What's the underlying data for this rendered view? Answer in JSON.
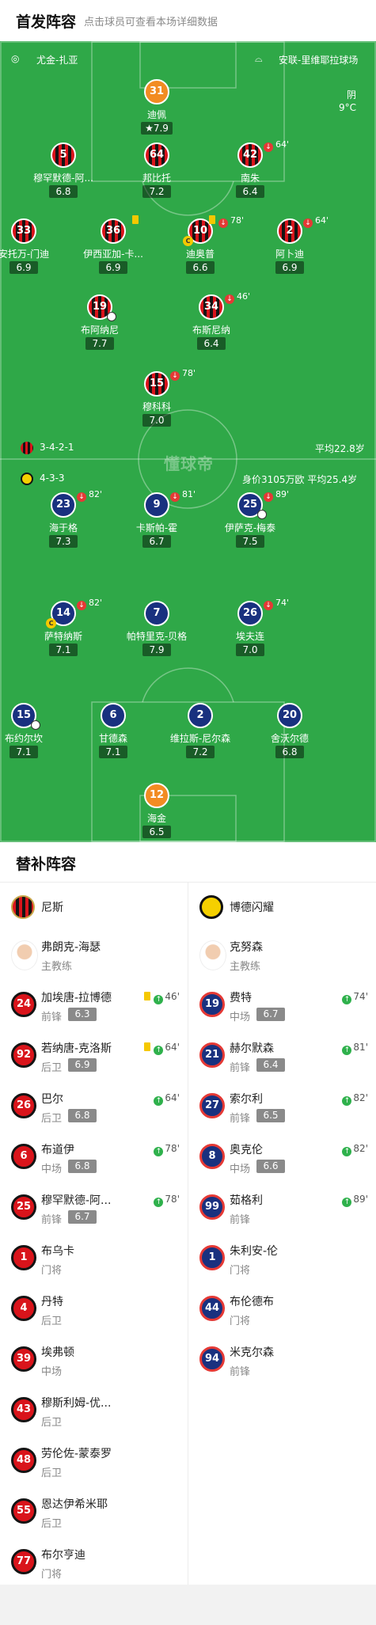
{
  "header": {
    "title": "首发阵容",
    "subtitle": "点击球员可查看本场详细数据"
  },
  "pitch": {
    "referee": "尤金-扎亚",
    "stadium": "安联-里维耶拉球场",
    "weather": "阴",
    "temperature": "9°C",
    "home": {
      "formation": "3-4-2-1",
      "avg_age": "平均22.8岁"
    },
    "away": {
      "formation": "4-3-3",
      "value_age": "身价3105万欧 平均25.4岁"
    },
    "watermark": "懂球帝"
  },
  "players": [
    {
      "num": "31",
      "name": "迪佩",
      "rating": "7.9",
      "team": "gk1"
    },
    {
      "num": "5",
      "name": "穆罕默德-阿...",
      "rating": "6.8",
      "team": "nice"
    },
    {
      "num": "64",
      "name": "邦比托",
      "rating": "7.2",
      "team": "nice"
    },
    {
      "num": "42",
      "name": "南朱",
      "rating": "6.4",
      "team": "nice",
      "sub": "64'"
    },
    {
      "num": "33",
      "name": "安托万-门迪",
      "rating": "6.9",
      "team": "nice"
    },
    {
      "num": "36",
      "name": "伊西亚加-卡...",
      "rating": "6.9",
      "team": "nice"
    },
    {
      "num": "10",
      "name": "迪奥普",
      "rating": "6.6",
      "team": "nice",
      "sub": "78'"
    },
    {
      "num": "2",
      "name": "阿卜迪",
      "rating": "6.9",
      "team": "nice",
      "sub": "64'"
    },
    {
      "num": "19",
      "name": "布阿纳尼",
      "rating": "7.7",
      "team": "nice"
    },
    {
      "num": "34",
      "name": "布斯尼纳",
      "rating": "6.4",
      "team": "nice",
      "sub": "46'"
    },
    {
      "num": "15",
      "name": "穆科科",
      "rating": "7.0",
      "team": "nice",
      "sub": "78'"
    },
    {
      "num": "23",
      "name": "海于格",
      "rating": "7.3",
      "team": "bod",
      "sub": "82'"
    },
    {
      "num": "9",
      "name": "卡斯帕-霍",
      "rating": "6.7",
      "team": "bod",
      "sub": "81'"
    },
    {
      "num": "25",
      "name": "伊萨克-梅泰",
      "rating": "7.5",
      "team": "bod",
      "sub": "89'"
    },
    {
      "num": "14",
      "name": "萨特纳斯",
      "rating": "7.1",
      "team": "bod",
      "sub": "82'"
    },
    {
      "num": "7",
      "name": "帕特里克-贝格",
      "rating": "7.9",
      "team": "bod"
    },
    {
      "num": "26",
      "name": "埃夫连",
      "rating": "7.0",
      "team": "bod",
      "sub": "74'"
    },
    {
      "num": "15",
      "name": "布约尔坎",
      "rating": "7.1",
      "team": "bod"
    },
    {
      "num": "6",
      "name": "甘德森",
      "rating": "7.1",
      "team": "bod"
    },
    {
      "num": "2",
      "name": "维拉斯-尼尔森",
      "rating": "7.2",
      "team": "bod"
    },
    {
      "num": "20",
      "name": "舍沃尔德",
      "rating": "6.8",
      "team": "bod"
    },
    {
      "num": "12",
      "name": "海金",
      "rating": "6.5",
      "team": "gk2"
    }
  ],
  "subs": {
    "title": "替补阵容",
    "home": {
      "team": "尼斯",
      "coach": {
        "name": "弗朗克-海瑟",
        "role": "主教练"
      },
      "players": [
        {
          "num": "24",
          "name": "加埃唐-拉博德",
          "pos": "前锋",
          "rating": "6.3",
          "event": "46'",
          "yellow": true
        },
        {
          "num": "92",
          "name": "若纳唐-克洛斯",
          "pos": "后卫",
          "rating": "6.9",
          "event": "64'",
          "yellow": true
        },
        {
          "num": "26",
          "name": "巴尔",
          "pos": "后卫",
          "rating": "6.8",
          "event": "64'"
        },
        {
          "num": "6",
          "name": "布道伊",
          "pos": "中场",
          "rating": "6.8",
          "event": "78'"
        },
        {
          "num": "25",
          "name": "穆罕默德-阿...",
          "pos": "前锋",
          "rating": "6.7",
          "event": "78'"
        },
        {
          "num": "1",
          "name": "布乌卡",
          "pos": "门将"
        },
        {
          "num": "4",
          "name": "丹特",
          "pos": "后卫"
        },
        {
          "num": "39",
          "name": "埃弗顿",
          "pos": "中场"
        },
        {
          "num": "43",
          "name": "穆斯利姆-优...",
          "pos": "后卫"
        },
        {
          "num": "48",
          "name": "劳伦佐-蒙泰罗",
          "pos": "后卫"
        },
        {
          "num": "55",
          "name": "恩达伊希米耶",
          "pos": "后卫"
        },
        {
          "num": "77",
          "name": "布尔亨迪",
          "pos": "门将"
        }
      ]
    },
    "away": {
      "team": "博德闪耀",
      "coach": {
        "name": "克努森",
        "role": "主教练"
      },
      "players": [
        {
          "num": "19",
          "name": "费特",
          "pos": "中场",
          "rating": "6.7",
          "event": "74'"
        },
        {
          "num": "21",
          "name": "赫尔默森",
          "pos": "前锋",
          "rating": "6.4",
          "event": "81'"
        },
        {
          "num": "27",
          "name": "索尔利",
          "pos": "前锋",
          "rating": "6.5",
          "event": "82'"
        },
        {
          "num": "8",
          "name": "奥克伦",
          "pos": "中场",
          "rating": "6.6",
          "event": "82'"
        },
        {
          "num": "99",
          "name": "茹格利",
          "pos": "前锋",
          "event": "89'"
        },
        {
          "num": "1",
          "name": "朱利安-伦",
          "pos": "门将"
        },
        {
          "num": "44",
          "name": "布伦德布",
          "pos": "门将"
        },
        {
          "num": "94",
          "name": "米克尔森",
          "pos": "前锋"
        }
      ]
    }
  }
}
